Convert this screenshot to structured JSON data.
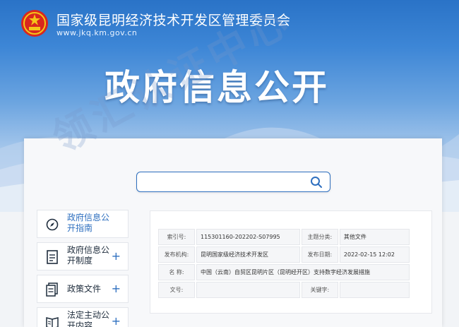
{
  "header": {
    "org_title": "国家级昆明经济技术开发区管理委员会",
    "url": "www.jkq.km.gov.cn",
    "banner_title": "政府信息公开"
  },
  "search": {
    "placeholder": "",
    "icon": "search-icon"
  },
  "sidebar": {
    "items": [
      {
        "label": "政府信息公开指南",
        "icon": "compass-icon",
        "has_plus": false
      },
      {
        "label": "政府信息公开制度",
        "icon": "document-icon",
        "has_plus": true
      },
      {
        "label": "政策文件",
        "icon": "files-icon",
        "has_plus": true
      },
      {
        "label": "法定主动公开内容",
        "icon": "book-icon",
        "has_plus": true
      }
    ],
    "plus": "+"
  },
  "meta": {
    "rows": [
      [
        {
          "k": "索引号:",
          "v": "115301160-202202-S07995"
        },
        {
          "k": "主题分类:",
          "v": "其他文件"
        }
      ],
      [
        {
          "k": "发布机构:",
          "v": "昆明国家级经济技术开发区"
        },
        {
          "k": "发布日期:",
          "v": "2022-02-15 12:02"
        }
      ],
      [
        {
          "k": "名 称:",
          "v": "中国（云南）自贸区昆明片区（昆明经开区）支持数字经济发展措施"
        }
      ],
      [
        {
          "k": "文号:",
          "v": ""
        },
        {
          "k": "关键字:",
          "v": ""
        }
      ]
    ]
  },
  "watermark": "领汇认证中心",
  "colors": {
    "primary": "#2e6fbf",
    "banner_top": "#2a73c7"
  }
}
